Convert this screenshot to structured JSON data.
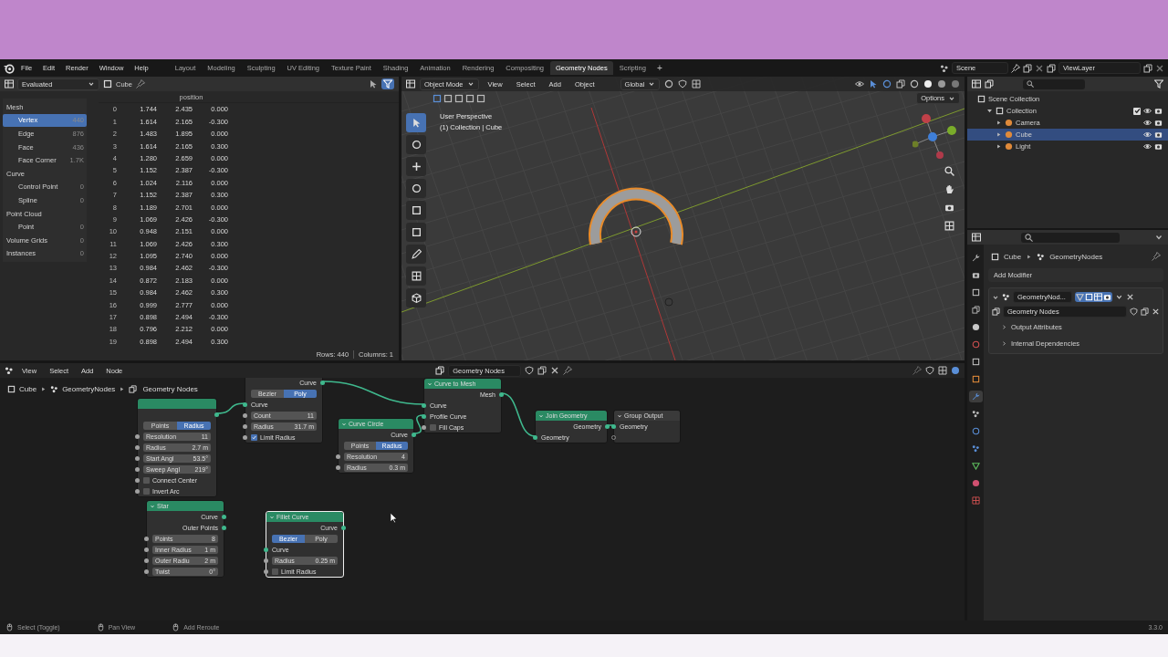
{
  "topbar": {
    "menus": [
      "File",
      "Edit",
      "Render",
      "Window",
      "Help"
    ],
    "workspaces": [
      {
        "label": "Layout",
        "selected": false
      },
      {
        "label": "Modeling",
        "selected": false
      },
      {
        "label": "Sculpting",
        "selected": false
      },
      {
        "label": "UV Editing",
        "selected": false
      },
      {
        "label": "Texture Paint",
        "selected": false
      },
      {
        "label": "Shading",
        "selected": false
      },
      {
        "label": "Animation",
        "selected": false
      },
      {
        "label": "Rendering",
        "selected": false
      },
      {
        "label": "Compositing",
        "selected": false
      },
      {
        "label": "Geometry Nodes",
        "selected": true
      },
      {
        "label": "Scripting",
        "selected": false
      }
    ],
    "add_workspace": "+",
    "scene": "Scene",
    "view_layer": "ViewLayer"
  },
  "spreadsheet": {
    "display_mode": "Evaluated",
    "object": "Cube",
    "tree": [
      {
        "label": "Mesh",
        "selected": false,
        "children": [
          {
            "label": "Vertex",
            "count": "440",
            "selected": true
          },
          {
            "label": "Edge",
            "count": "876",
            "selected": false
          },
          {
            "label": "Face",
            "count": "436",
            "selected": false
          },
          {
            "label": "Face Corner",
            "count": "1.7K",
            "selected": false
          }
        ]
      },
      {
        "label": "Curve",
        "selected": false,
        "children": [
          {
            "label": "Control Point",
            "count": "0",
            "selected": false
          },
          {
            "label": "Spline",
            "count": "0",
            "selected": false
          }
        ]
      },
      {
        "label": "Point Cloud",
        "selected": false,
        "children": [
          {
            "label": "Point",
            "count": "0",
            "selected": false
          }
        ]
      },
      {
        "label": "Volume Grids",
        "count": "0",
        "selected": false
      },
      {
        "label": "Instances",
        "count": "0",
        "selected": false
      }
    ],
    "column_header": "position",
    "rows": [
      [
        "0",
        "1.744",
        "2.435",
        "0.000"
      ],
      [
        "1",
        "1.614",
        "2.165",
        "-0.300"
      ],
      [
        "2",
        "1.483",
        "1.895",
        "0.000"
      ],
      [
        "3",
        "1.614",
        "2.165",
        "0.300"
      ],
      [
        "4",
        "1.280",
        "2.659",
        "0.000"
      ],
      [
        "5",
        "1.152",
        "2.387",
        "-0.300"
      ],
      [
        "6",
        "1.024",
        "2.116",
        "0.000"
      ],
      [
        "7",
        "1.152",
        "2.387",
        "0.300"
      ],
      [
        "8",
        "1.189",
        "2.701",
        "0.000"
      ],
      [
        "9",
        "1.069",
        "2.426",
        "-0.300"
      ],
      [
        "10",
        "0.948",
        "2.151",
        "0.000"
      ],
      [
        "11",
        "1.069",
        "2.426",
        "0.300"
      ],
      [
        "12",
        "1.095",
        "2.740",
        "0.000"
      ],
      [
        "13",
        "0.984",
        "2.462",
        "-0.300"
      ],
      [
        "14",
        "0.872",
        "2.183",
        "0.000"
      ],
      [
        "15",
        "0.984",
        "2.462",
        "0.300"
      ],
      [
        "16",
        "0.999",
        "2.777",
        "0.000"
      ],
      [
        "17",
        "0.898",
        "2.494",
        "-0.300"
      ],
      [
        "18",
        "0.796",
        "2.212",
        "0.000"
      ],
      [
        "19",
        "0.898",
        "2.494",
        "0.300"
      ]
    ],
    "rows_count": "Rows: 440",
    "columns_count": "Columns: 1"
  },
  "viewport": {
    "mode": "Object Mode",
    "menus": [
      "View",
      "Select",
      "Add",
      "Object"
    ],
    "orientation": "Global",
    "options": "Options",
    "overlay_lines": [
      "User Perspective",
      "(1) Collection | Cube"
    ],
    "tools": [
      {
        "selected": true
      },
      {
        "selected": false
      },
      {
        "selected": false
      },
      {
        "selected": false
      },
      {
        "selected": false
      },
      {
        "selected": false
      },
      {
        "selected": false
      },
      {
        "selected": false
      },
      {
        "selected": false
      }
    ]
  },
  "outliner": {
    "items": [
      {
        "label": "Scene Collection",
        "selected": false,
        "children": [
          {
            "label": "Collection",
            "selected": false,
            "expanded": true,
            "checked": true,
            "children": [
              {
                "label": "Camera",
                "selected": false,
                "expanded": false
              },
              {
                "label": "Cube",
                "selected": true,
                "expanded": false
              },
              {
                "label": "Light",
                "selected": false,
                "expanded": false
              }
            ]
          }
        ]
      }
    ]
  },
  "properties": {
    "breadcrumb": [
      "Cube",
      "GeometryNodes"
    ],
    "add_modifier": "Add Modifier",
    "tabs": [
      {
        "selected": false
      },
      {
        "selected": false
      },
      {
        "selected": false
      },
      {
        "selected": false
      },
      {
        "selected": false
      },
      {
        "selected": false
      },
      {
        "selected": false
      },
      {
        "selected": false
      },
      {
        "selected": true
      },
      {
        "selected": false
      },
      {
        "selected": false
      },
      {
        "selected": false
      },
      {
        "selected": false
      },
      {
        "selected": false
      },
      {
        "selected": false
      }
    ],
    "modifier": {
      "name": "GeometryNod...",
      "expanded": true,
      "node_group": "Geometry Nodes",
      "panels": [
        {
          "label": "Output Attributes",
          "expanded": false
        },
        {
          "label": "Internal Dependencies",
          "expanded": false
        }
      ]
    }
  },
  "node_editor": {
    "menus": [
      "View",
      "Select",
      "Add",
      "Node"
    ],
    "node_group": "Geometry Nodes",
    "breadcrumb": [
      "Cube",
      "GeometryNodes",
      "Geometry Nodes"
    ],
    "nodes": [
      {
        "kind": "curve",
        "selected": false,
        "items": [
          {
            "kind": "socket_out"
          },
          {
            "kind": "mode",
            "options": [
              {
                "label": "Points",
                "selected": false
              },
              {
                "label": "Radius",
                "selected": true
              }
            ]
          },
          {
            "kind": "field",
            "label": "Resolution",
            "value": "11"
          },
          {
            "kind": "field",
            "label": "Radius",
            "value": "2.7 m"
          },
          {
            "kind": "field",
            "label": "Start Angl",
            "value": "53.5°"
          },
          {
            "kind": "field",
            "label": "Sweep Angl",
            "value": "219°"
          },
          {
            "kind": "check",
            "label": "Connect Center",
            "checked": false
          },
          {
            "kind": "check",
            "label": "Invert Arc",
            "checked": false
          }
        ]
      },
      {
        "kind": "curve",
        "selected": false,
        "items": [
          {
            "kind": "output",
            "label": "Curve"
          },
          {
            "kind": "mode",
            "options": [
              {
                "label": "Bezier",
                "selected": false
              },
              {
                "label": "Poly",
                "selected": true
              }
            ]
          },
          {
            "kind": "input",
            "label": "Curve"
          },
          {
            "kind": "field",
            "label": "Count",
            "value": "11"
          },
          {
            "kind": "field",
            "label": "Radius",
            "value": "31.7 m"
          },
          {
            "kind": "check",
            "label": "Limit Radius",
            "checked": true
          }
        ]
      },
      {
        "kind": "curve",
        "title": "Curve Circle",
        "selected": false,
        "items": [
          {
            "kind": "output",
            "label": "Curve"
          },
          {
            "kind": "mode",
            "options": [
              {
                "label": "Points",
                "selected": false
              },
              {
                "label": "Radius",
                "selected": true
              }
            ]
          },
          {
            "kind": "field",
            "label": "Resolution",
            "value": "4"
          },
          {
            "kind": "field",
            "label": "Radius",
            "value": "0.3 m"
          }
        ]
      },
      {
        "kind": "curve",
        "title": "Curve to Mesh",
        "selected": false,
        "items": [
          {
            "kind": "output",
            "label": "Mesh"
          },
          {
            "kind": "input",
            "label": "Curve"
          },
          {
            "kind": "input",
            "label": "Profile Curve"
          },
          {
            "kind": "check",
            "label": "Fill Caps",
            "checked": false
          }
        ]
      },
      {
        "kind": "curve",
        "title": "Join Geometry",
        "selected": false,
        "items": [
          {
            "kind": "output",
            "label": "Geometry"
          },
          {
            "kind": "input",
            "label": "Geometry"
          }
        ]
      },
      {
        "kind": "group",
        "title": "Group Output",
        "selected": false,
        "items": [
          {
            "kind": "input",
            "label": "Geometry"
          },
          {
            "kind": "socket_in"
          }
        ]
      },
      {
        "kind": "curve",
        "title": "Star",
        "selected": false,
        "items": [
          {
            "kind": "output",
            "label": "Curve"
          },
          {
            "kind": "output",
            "label": "Outer Points"
          },
          {
            "kind": "field",
            "label": "Points",
            "value": "8"
          },
          {
            "kind": "field",
            "label": "Inner Radius",
            "value": "1 m"
          },
          {
            "kind": "field",
            "label": "Outer Radiu",
            "value": "2 m"
          },
          {
            "kind": "field",
            "label": "Twist",
            "value": "0°"
          }
        ]
      },
      {
        "kind": "curve",
        "title": "Fillet Curve",
        "selected": true,
        "items": [
          {
            "kind": "output",
            "label": "Curve"
          },
          {
            "kind": "mode",
            "options": [
              {
                "label": "Bezier",
                "selected": true
              },
              {
                "label": "Poly",
                "selected": false
              }
            ]
          },
          {
            "kind": "input",
            "label": "Curve"
          },
          {
            "kind": "field",
            "label": "Radius",
            "value": "0.25 m"
          },
          {
            "kind": "check",
            "label": "Limit Radius",
            "checked": false
          }
        ]
      }
    ]
  },
  "status_bar": {
    "hints": [
      "Select (Toggle)",
      "Pan View",
      "Add Reroute"
    ],
    "version": "3.3.0"
  }
}
